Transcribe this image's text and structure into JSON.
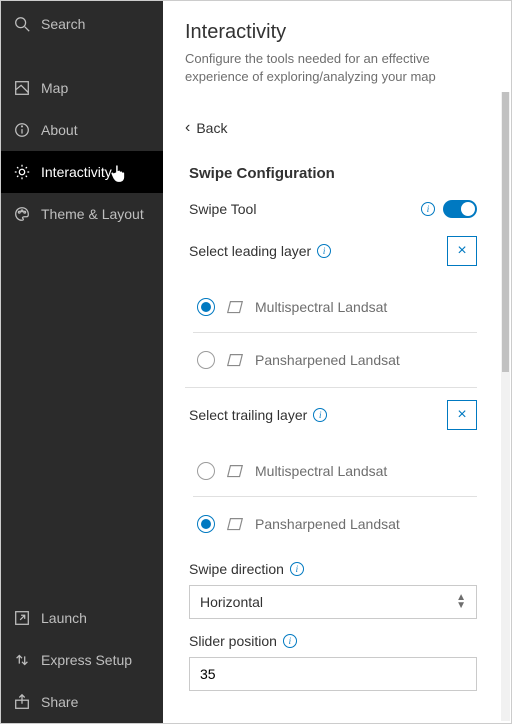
{
  "sidebar": {
    "search": "Search",
    "items": [
      {
        "label": "Map"
      },
      {
        "label": "About"
      },
      {
        "label": "Interactivity"
      },
      {
        "label": "Theme & Layout"
      }
    ],
    "footer": [
      {
        "label": "Launch"
      },
      {
        "label": "Express Setup"
      },
      {
        "label": "Share"
      }
    ]
  },
  "header": {
    "title": "Interactivity",
    "subtitle": "Configure the tools needed for an effective experience of exploring/analyzing your map"
  },
  "panel": {
    "back": "Back",
    "section_title": "Swipe Configuration",
    "swipe_tool_label": "Swipe Tool",
    "swipe_tool_on": true,
    "leading": {
      "label": "Select leading layer",
      "options": [
        {
          "label": "Multispectral Landsat",
          "selected": true
        },
        {
          "label": "Pansharpened Landsat",
          "selected": false
        }
      ]
    },
    "trailing": {
      "label": "Select trailing layer",
      "options": [
        {
          "label": "Multispectral Landsat",
          "selected": false
        },
        {
          "label": "Pansharpened Landsat",
          "selected": true
        }
      ]
    },
    "direction": {
      "label": "Swipe direction",
      "value": "Horizontal"
    },
    "slider": {
      "label": "Slider position",
      "value": "35"
    }
  },
  "info_glyph": "i",
  "close_glyph": "×"
}
